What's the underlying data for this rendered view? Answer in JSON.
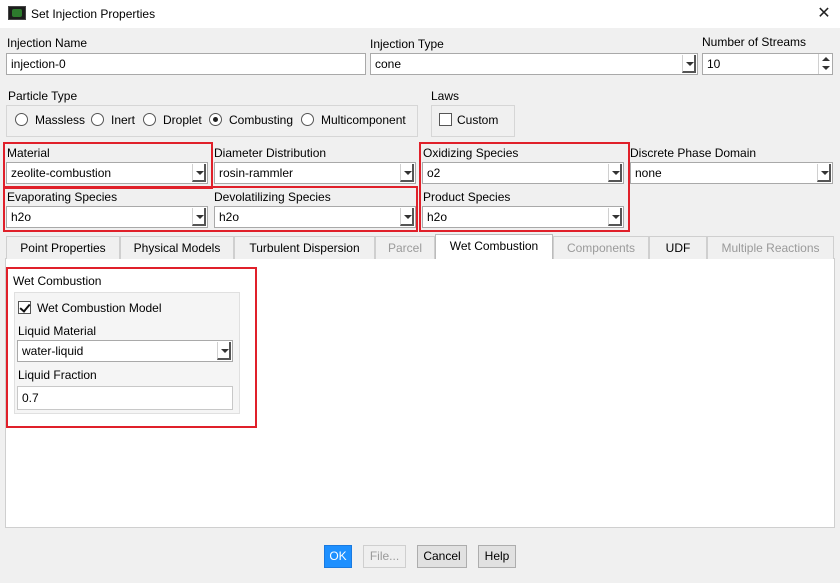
{
  "window": {
    "title": "Set Injection Properties",
    "icon": "app-icon",
    "close": "✕"
  },
  "injection_name": {
    "label": "Injection Name",
    "value": "injection-0"
  },
  "injection_type": {
    "label": "Injection Type",
    "value": "cone"
  },
  "number_of_streams": {
    "label": "Number of Streams",
    "value": "10"
  },
  "particle_type": {
    "label": "Particle Type",
    "options": [
      "Massless",
      "Inert",
      "Droplet",
      "Combusting",
      "Multicomponent"
    ],
    "selected": "Combusting"
  },
  "laws": {
    "label": "Laws",
    "custom_label": "Custom",
    "custom_checked": false
  },
  "material": {
    "label": "Material",
    "value": "zeolite-combustion"
  },
  "diameter_distribution": {
    "label": "Diameter Distribution",
    "value": "rosin-rammler"
  },
  "oxidizing_species": {
    "label": "Oxidizing Species",
    "value": "o2"
  },
  "discrete_phase_domain": {
    "label": "Discrete Phase Domain",
    "value": "none"
  },
  "evaporating_species": {
    "label": "Evaporating Species",
    "value": "h2o"
  },
  "devolatilizing_species": {
    "label": "Devolatilizing Species",
    "value": "h2o"
  },
  "product_species": {
    "label": "Product Species",
    "value": "h2o"
  },
  "tabs": [
    {
      "label": "Point Properties",
      "state": "normal"
    },
    {
      "label": "Physical Models",
      "state": "normal"
    },
    {
      "label": "Turbulent Dispersion",
      "state": "normal"
    },
    {
      "label": "Parcel",
      "state": "disabled"
    },
    {
      "label": "Wet Combustion",
      "state": "active"
    },
    {
      "label": "Components",
      "state": "disabled"
    },
    {
      "label": "UDF",
      "state": "normal"
    },
    {
      "label": "Multiple Reactions",
      "state": "disabled"
    }
  ],
  "wet_combustion": {
    "group_label": "Wet Combustion",
    "model_label": "Wet Combustion Model",
    "model_checked": true,
    "liquid_material_label": "Liquid Material",
    "liquid_material_value": "water-liquid",
    "liquid_fraction_label": "Liquid Fraction",
    "liquid_fraction_value": "0.7"
  },
  "buttons": {
    "ok": "OK",
    "file": "File...",
    "cancel": "Cancel",
    "help": "Help"
  },
  "colors": {
    "highlight_box": "#e0202a",
    "primary_button": "#1e90ff"
  }
}
